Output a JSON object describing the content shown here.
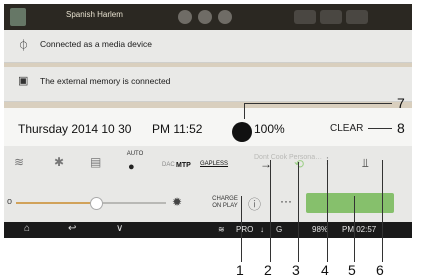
{
  "now_playing": {
    "song": "Spanish Harlem"
  },
  "notifications": [
    {
      "icon": "usb-icon",
      "text": "Connected as a media device"
    },
    {
      "icon": "memory-icon",
      "text": "The external memory is connected"
    }
  ],
  "status": {
    "date": "Thursday 2014 10 30",
    "time": "PM 11:52",
    "battery": "100%",
    "clear_label": "CLEAR"
  },
  "toggles": {
    "auto_label": "AUTO",
    "dac_label": "DAC",
    "mtp_label": "MTP",
    "gapless_label": "GAPLESS",
    "charge_label": "CHARGE ON PLAY",
    "more_label": "···"
  },
  "navbar": {
    "pro": "PRO",
    "g": "G",
    "battery": "98%",
    "time": "PM 02:57"
  },
  "callouts": [
    "1",
    "2",
    "3",
    "4",
    "5",
    "6",
    "7",
    "8"
  ]
}
